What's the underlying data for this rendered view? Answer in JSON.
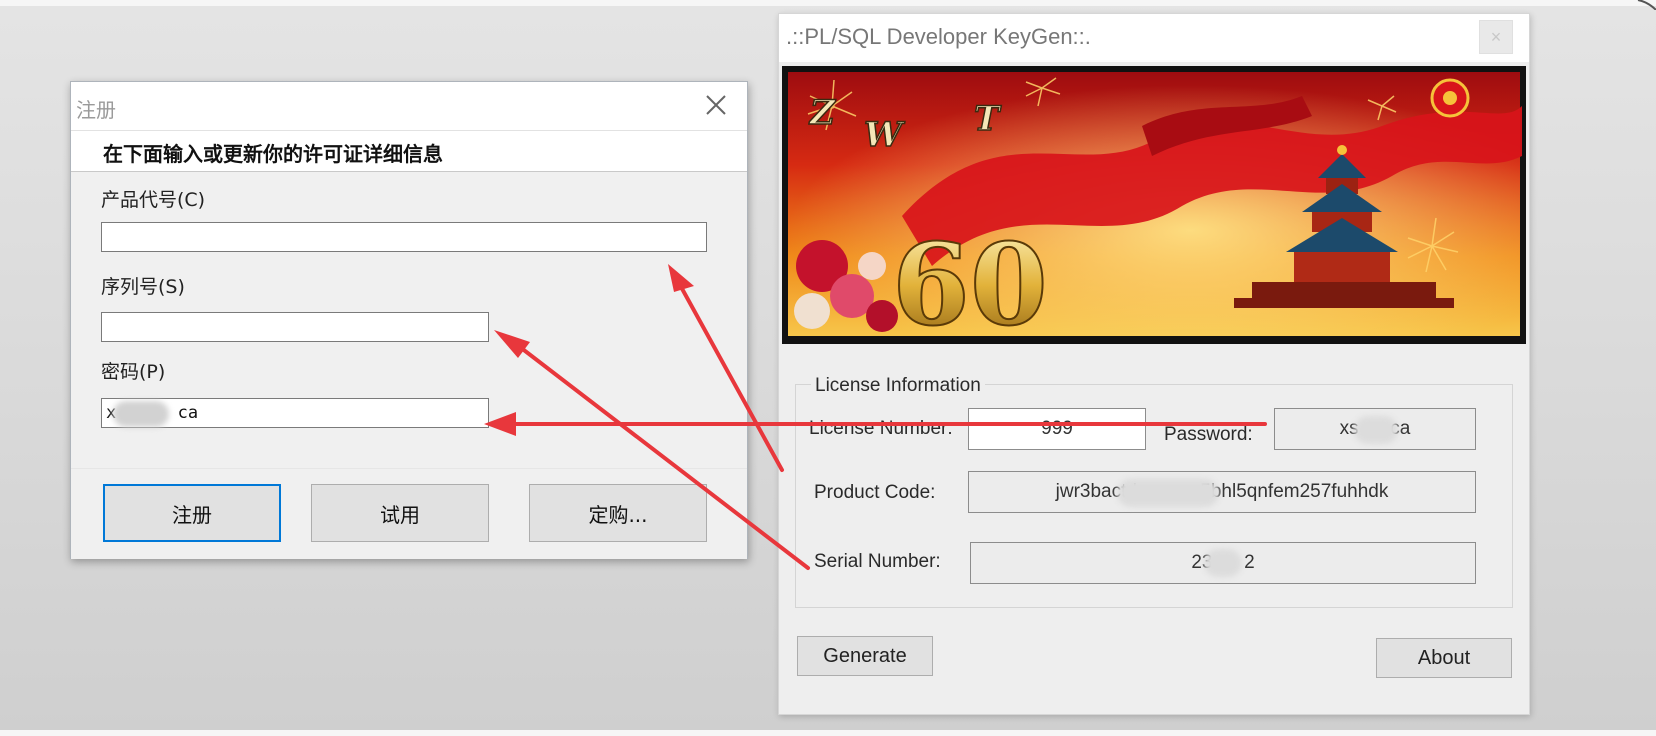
{
  "register_dialog": {
    "title": "注册",
    "header": "在下面输入或更新你的许可证详细信息",
    "product_code_label": "产品代号(C)",
    "product_code_value": "",
    "serial_label": "序列号(S)",
    "serial_value": "",
    "password_label": "密码(P)",
    "password_value": "x      ca",
    "buttons": {
      "register": "注册",
      "trial": "试用",
      "buy": "定购..."
    }
  },
  "keygen": {
    "title": ".::PL/SQL Developer KeyGen::.",
    "close_label": "×",
    "banner_text": {
      "letters": [
        "Z",
        "W",
        "T"
      ],
      "number": "60"
    },
    "group_label": "License Information",
    "license_number_label": "License Number:",
    "license_number_value": "999",
    "password_label": "Password:",
    "password_value": "xs      ca",
    "product_code_label": "Product Code:",
    "product_code_value": "jwr3bactd            5bhl5qnfem257fuhhdk",
    "serial_label": "Serial Number:",
    "serial_value": "23      2",
    "generate_label": "Generate",
    "about_label": "About"
  },
  "colors": {
    "arrow": "#e8373c",
    "focus_border": "#0078d7",
    "banner_red": "#c8101a",
    "banner_gold": "#f6c23a"
  },
  "icons": [
    "close-icon",
    "keygen-close-icon"
  ]
}
